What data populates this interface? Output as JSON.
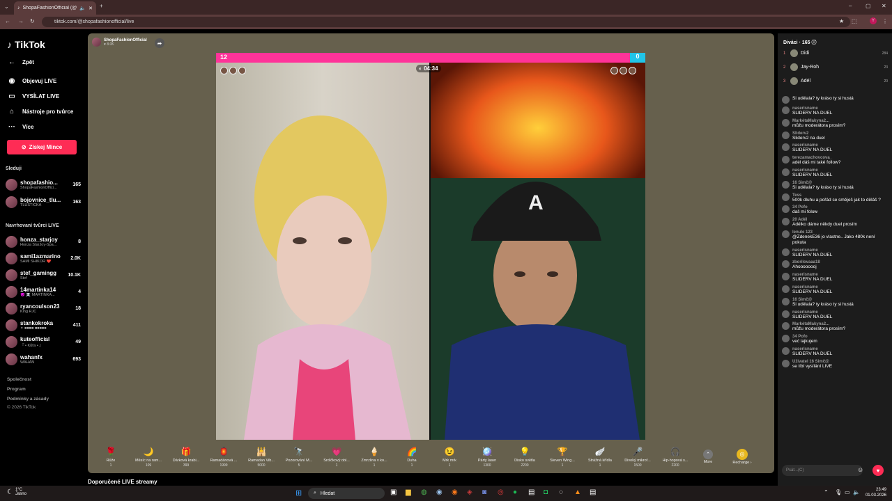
{
  "browser": {
    "tab_title": "ShopaFashionOfficial (@sh",
    "url": "tiktok.com/@shopafashionofficial/live"
  },
  "sidebar": {
    "logo": "TikTok",
    "back": "Zpět",
    "nav": [
      "Objevuj LIVE",
      "VYSÍLAT LIVE",
      "Nástroje pro tvůrce",
      "Více"
    ],
    "coins_button": "Získej Mince",
    "following_label": "Sleduji",
    "following": [
      {
        "name": "shopafashio...",
        "sub": "ShopaFashionOffici...",
        "count": "165"
      },
      {
        "name": "bojovnice_tlu...",
        "sub": "TLUSTIČKA",
        "count": "163"
      }
    ],
    "suggested_label": "Navrhovaní tvůrci LIVE",
    "suggested": [
      {
        "name": "honza_starjoy",
        "sub": "Honza StarJoy-Spa...",
        "count": "8"
      },
      {
        "name": "sami1azmarino",
        "sub": "SAMI SHIKOR ❤️",
        "count": "2.0K"
      },
      {
        "name": "stef_gamingg",
        "sub": "Stef",
        "count": "10.1K"
      },
      {
        "name": "14martinka14",
        "sub": "😈 ☠️ MARTINKA...",
        "count": "4"
      },
      {
        "name": "ryancoulson23",
        "sub": "King RJC",
        "count": "18"
      },
      {
        "name": "stankokroka",
        "sub": "✦ ■■■■ ■■■■■",
        "count": "411"
      },
      {
        "name": "kuteofficial",
        "sub": "『 • Kůťa • 』",
        "count": "49"
      },
      {
        "name": "wahanfx",
        "sub": "WAHAN",
        "count": "693"
      }
    ],
    "footer": [
      "Společnost",
      "Program",
      "Podmínky a zásady",
      "© 2026 TikTok"
    ]
  },
  "stream": {
    "host_name": "ShopaFashionOfficial",
    "host_likes": "♥ 8.0K",
    "score_left": "12",
    "score_right": "0",
    "timer": "04:34"
  },
  "gifts": [
    {
      "name": "Růže",
      "price": "1",
      "icon": "🌹"
    },
    {
      "name": "Měsíc na ram...",
      "price": "109",
      "icon": "🌙"
    },
    {
      "name": "Dárková krabi...",
      "price": "399",
      "icon": "🎁"
    },
    {
      "name": "Ramadánová ...",
      "price": "1999",
      "icon": "🏮"
    },
    {
      "name": "Ramadan Vib...",
      "price": "5000",
      "icon": "🕌"
    },
    {
      "name": "Pozorování M...",
      "price": "5",
      "icon": "🔭"
    },
    {
      "name": "Srdíčkový obl...",
      "price": "1",
      "icon": "💗"
    },
    {
      "name": "Zmrzlina v ko...",
      "price": "1",
      "icon": "🍦"
    },
    {
      "name": "Duha",
      "price": "1",
      "icon": "🌈"
    },
    {
      "name": "Mrk mrk",
      "price": "1",
      "icon": "😉"
    },
    {
      "name": "Párty laser",
      "price": "1300",
      "icon": "🪩"
    },
    {
      "name": "Disko světla",
      "price": "2200",
      "icon": "💡"
    },
    {
      "name": "Steven Wing...",
      "price": "1",
      "icon": "🏆"
    },
    {
      "name": "Strážná křídla",
      "price": "1",
      "icon": "🪽"
    },
    {
      "name": "Divoký mikrof...",
      "price": "1500",
      "icon": "🎤"
    },
    {
      "name": "Hip-hopová s...",
      "price": "2200",
      "icon": "🎧"
    }
  ],
  "gift_more": "More",
  "gift_recharge": "Recharge ›",
  "recommended_heading": "Doporučené LIVE streamy",
  "viewers": {
    "heading": "Diváci · 165",
    "top": [
      {
        "rank": "1",
        "name": "Didi",
        "count": "284"
      },
      {
        "rank": "2",
        "name": "Jay-Roh",
        "count": "23"
      },
      {
        "rank": "3",
        "name": "Adél",
        "count": "20"
      }
    ]
  },
  "chat": [
    {
      "user": "",
      "text": "Si udělala? ty kráso ty si hustá"
    },
    {
      "user": "naserisname",
      "text": "SLIDERV NA DUEL"
    },
    {
      "user": "MarkétaMakyna2...",
      "text": "můžu moderátora prosím?"
    },
    {
      "user": "Sliderv2",
      "text": "Sliderv2 na duel"
    },
    {
      "user": "naserisname",
      "text": "SLIDERV NA DUEL"
    },
    {
      "user": "terezamachovcova_",
      "text": "adél dáš mi také follow?"
    },
    {
      "user": "naserisname",
      "text": "SLIDERV NA DUEL"
    },
    {
      "user": "16 Simč@",
      "text": "Si udělala? ty kráso ty si hustá"
    },
    {
      "user": "Tess",
      "text": "500k dluhu a pořád se směješ jak to děláš ?"
    },
    {
      "user": "34 Pofo",
      "text": "daš mi folow"
    },
    {
      "user": "20 Adél",
      "text": "Adélko dáme někdy duel prosím"
    },
    {
      "user": "lenule 123",
      "text": "@ZdenekE36 jo vlastne.. Jako 480k není pokuta"
    },
    {
      "user": "naserisname",
      "text": "SLIDERV NA DUEL"
    },
    {
      "user": "zborilovaaa18",
      "text": "Ahoooooooj"
    },
    {
      "user": "naserisname",
      "text": "SLIDERV NA DUEL"
    },
    {
      "user": "naserisname",
      "text": "SLIDERV NA DUEL"
    },
    {
      "user": "16 Simč@",
      "text": "Si udělala? ty kráso ty si hustá"
    },
    {
      "user": "naserisname",
      "text": "SLIDERV NA DUEL"
    },
    {
      "user": "MarkétaMakyna2...",
      "text": "můžu moderátora prosím?"
    },
    {
      "user": "34 Pofo",
      "text": "već lajkujem"
    },
    {
      "user": "naserisname",
      "text": "SLIDERV NA DUEL"
    },
    {
      "user": "Uživatel 16 Simč@",
      "text": "se líbí vysílání LIVE"
    }
  ],
  "chat_input_placeholder": "Psát...(C)",
  "taskbar": {
    "weather_temp": "1°C",
    "weather_desc": "Jasno",
    "search": "Hledat",
    "time": "23:49",
    "date": "01.03.2026"
  },
  "colors": {
    "accent": "#fe2c55",
    "score_left": "#ff3399",
    "score_right": "#21c4e8"
  }
}
